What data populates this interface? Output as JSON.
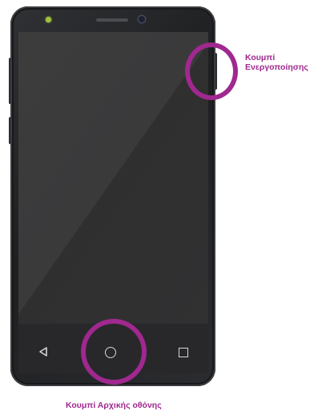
{
  "callouts": {
    "power": {
      "line1": "Κουμπί",
      "line2": "Ενεργοποίησης"
    },
    "home": {
      "text": "Κουμπί Αρχικής οθόνης"
    }
  },
  "navbar": {
    "back_icon": "back-triangle-icon",
    "home_icon": "home-circle-icon",
    "recent_icon": "recent-apps-square-icon"
  },
  "colors": {
    "highlight": "#a0288f",
    "screen": "#3a3a3b",
    "body": "#1e1f21",
    "led": "#9fc33a"
  }
}
